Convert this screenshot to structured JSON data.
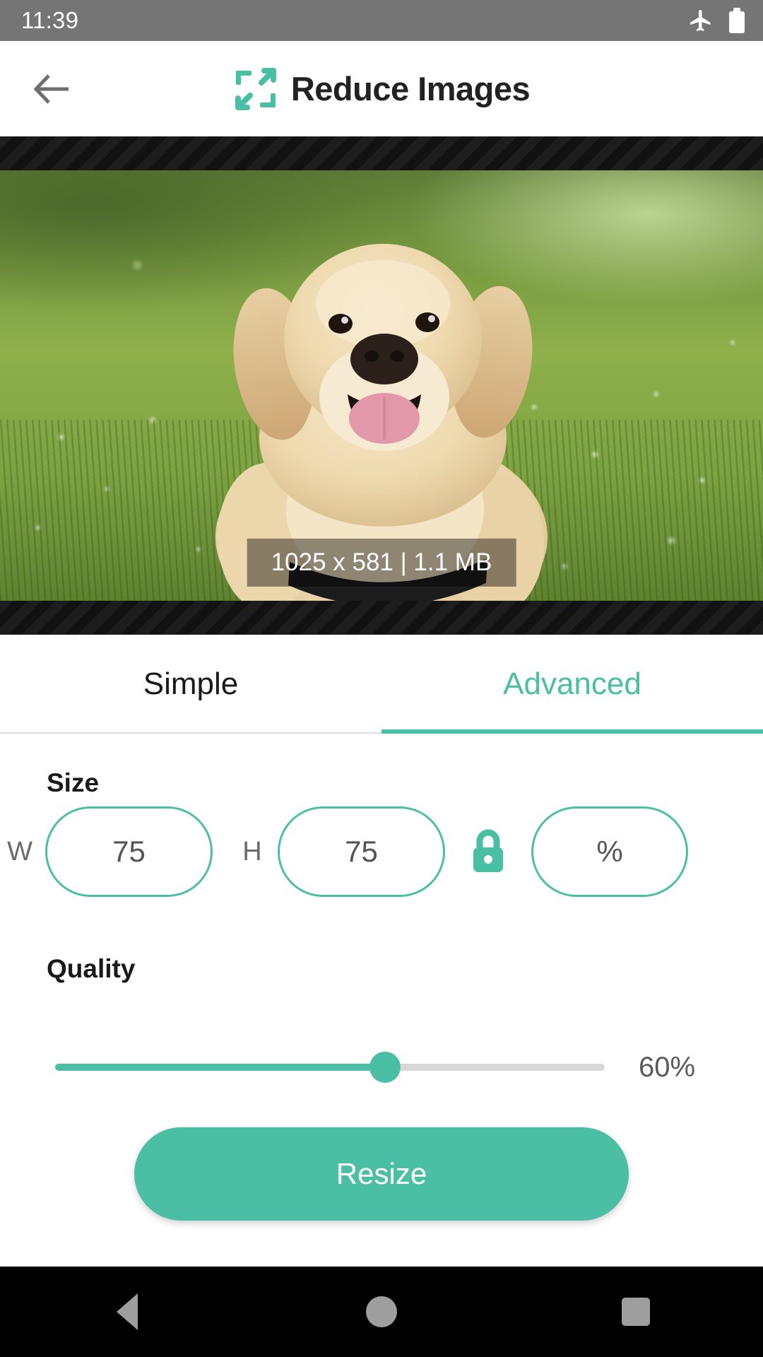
{
  "status_bar": {
    "time": "11:39",
    "icons": [
      "airplane-mode-icon",
      "battery-full-icon"
    ]
  },
  "app_bar": {
    "back_icon": "arrow-left-icon",
    "logo_icon": "reduce-images-logo-icon",
    "title": "Reduce Images"
  },
  "preview": {
    "caption": "1025 x 581 | 1.1 MB",
    "image_description": "golden retriever lying in grass with daisies"
  },
  "tabs": [
    {
      "label": "Simple",
      "active": false
    },
    {
      "label": "Advanced",
      "active": true
    }
  ],
  "size": {
    "heading": "Size",
    "width_label": "W",
    "width_value": "75",
    "height_label": "H",
    "height_value": "75",
    "lock_icon": "lock-closed-icon",
    "unit_value": "%"
  },
  "quality": {
    "heading": "Quality",
    "value_label": "60%",
    "percent": 60
  },
  "actions": {
    "resize_label": "Resize"
  },
  "nav_bar": {
    "back": "nav-back-icon",
    "home": "nav-home-icon",
    "recents": "nav-recents-icon"
  },
  "colors": {
    "accent": "#4bbfa3",
    "status_bar": "#757575",
    "nav_bar": "#000000",
    "text_primary": "#1a1a1a",
    "text_muted": "#6b6b6b"
  }
}
